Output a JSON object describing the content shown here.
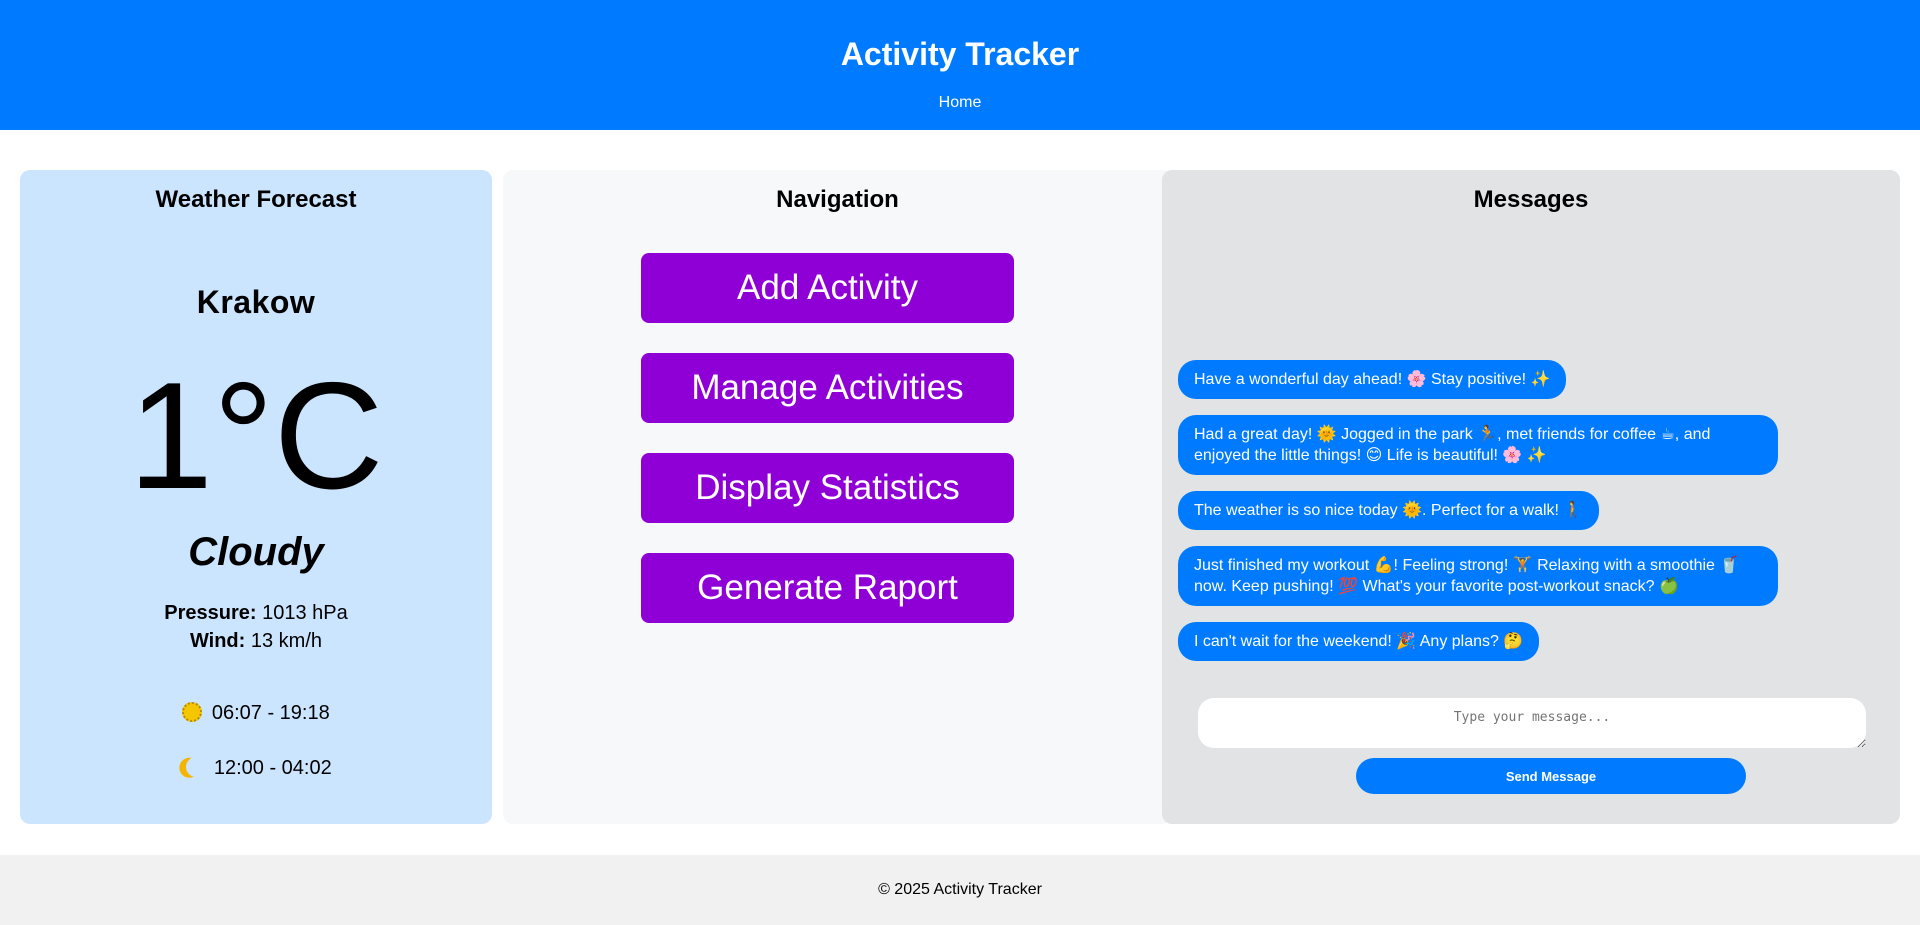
{
  "header": {
    "title": "Activity Tracker",
    "nav_home": "Home"
  },
  "weather": {
    "heading": "Weather Forecast",
    "city": "Krakow",
    "temperature": "1°C",
    "condition": "Cloudy",
    "pressure_label": "Pressure:",
    "pressure_value": "1013 hPa",
    "wind_label": "Wind:",
    "wind_value": "13 km/h",
    "sun_times": "06:07 - 19:18",
    "moon_times": "12:00 - 04:02",
    "sun_icon": "sun-icon",
    "moon_icon": "moon-icon"
  },
  "navigation": {
    "heading": "Navigation",
    "buttons": [
      "Add Activity",
      "Manage Activities",
      "Display Statistics",
      "Generate Raport"
    ],
    "button_color": "#8f00d7"
  },
  "messages": {
    "heading": "Messages",
    "items": [
      "Have a wonderful day ahead! 🌸 Stay positive! ✨",
      "Had a great day! 🌞 Jogged in the park 🏃, met friends for coffee ☕, and enjoyed the little things! 😊 Life is beautiful! 🌸 ✨",
      "The weather is so nice today 🌞. Perfect for a walk! 🚶",
      "Just finished my workout 💪! Feeling strong! 🏋 Relaxing with a smoothie 🥤 now. Keep pushing! 💯 What's your favorite post-workout snack? 🍏",
      "I can't wait for the weekend! 🎉 Any plans? 🤔"
    ],
    "input_placeholder": "Type your message...",
    "send_label": "Send Message",
    "bubble_color": "#007bff"
  },
  "footer": {
    "text": "© 2025 Activity Tracker"
  },
  "colors": {
    "header_bg": "#007bff",
    "weather_bg": "#cce5ff",
    "navigation_bg": "#f7f8fa",
    "messages_bg": "#e2e3e5",
    "footer_bg": "#f1f1f1"
  }
}
